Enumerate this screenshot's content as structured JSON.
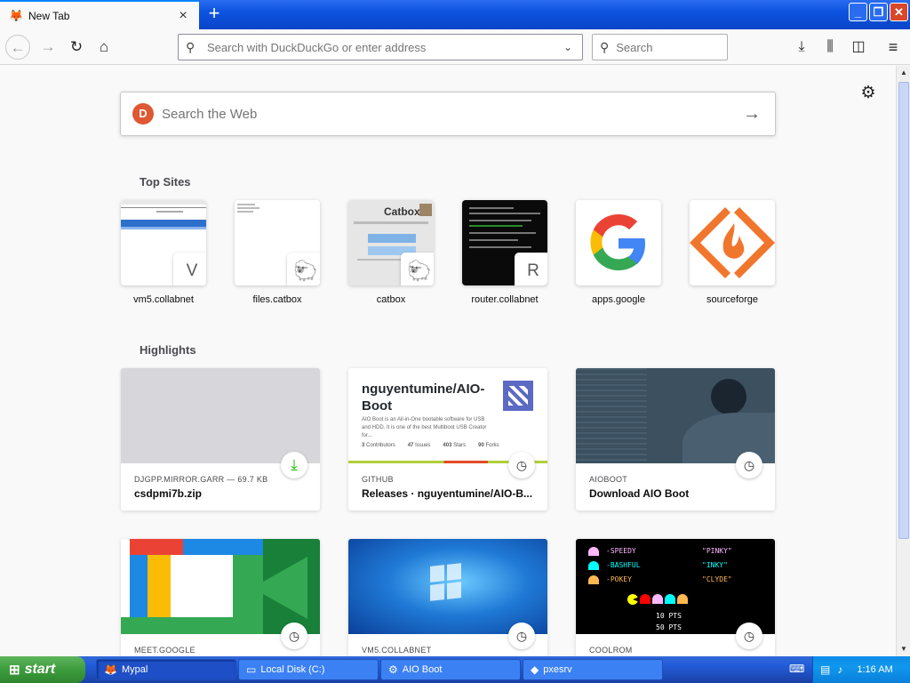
{
  "tab": {
    "title": "New Tab",
    "close_icon": "close-icon",
    "new_tab_icon": "plus-icon"
  },
  "window_buttons": {
    "minimize": "_",
    "maximize": "❐",
    "close": "✕"
  },
  "toolbar": {
    "url_placeholder": "Search with DuckDuckGo or enter address",
    "search_placeholder": "Search"
  },
  "newtab": {
    "search_placeholder": "Search the Web",
    "top_sites_title": "Top Sites",
    "highlights_title": "Highlights",
    "top_sites": [
      {
        "label": "vm5.collabnet",
        "badge": "V"
      },
      {
        "label": "files.catbox",
        "badge": ""
      },
      {
        "label": "catbox",
        "badge": ""
      },
      {
        "label": "router.collabnet",
        "badge": "R"
      },
      {
        "label": "apps.google",
        "badge": ""
      },
      {
        "label": "sourceforge",
        "badge": ""
      }
    ],
    "catbox_logo": "Catbox",
    "highlights": [
      {
        "source": "DJGPP.MIRROR.GARR — 69.7 KB",
        "title": "csdpmi7b.zip"
      },
      {
        "source": "GITHUB",
        "title": "Releases · nguyentumine/AIO-B..."
      },
      {
        "source": "AIOBOOT",
        "title": "Download AIO Boot"
      },
      {
        "source": "MEET.GOOGLE",
        "title": ""
      },
      {
        "source": "VM5.COLLABNET",
        "title": ""
      },
      {
        "source": "COOLROM",
        "title": ""
      }
    ],
    "github_card": {
      "repo": "nguyentumine/AIO-Boot",
      "desc": "AIO Boot is an All-in-One bootable software for USB and HDD. It is one of the best Multiboot USB Creator for...",
      "stats": [
        {
          "num": "3",
          "label": "Contributors"
        },
        {
          "num": "47",
          "label": "Issues"
        },
        {
          "num": "403",
          "label": "Stars"
        },
        {
          "num": "90",
          "label": "Forks"
        }
      ]
    },
    "pacman": [
      {
        "name": "-SPEEDY",
        "nick": "\"PINKY\""
      },
      {
        "name": "-BASHFUL",
        "nick": "\"INKY\""
      },
      {
        "name": "-POKEY",
        "nick": "\"CLYDE\""
      }
    ],
    "pacman_pts": [
      "10 PTS",
      "50 PTS"
    ]
  },
  "taskbar": {
    "start": "start",
    "tasks": [
      {
        "label": "Mypal",
        "active": true
      },
      {
        "label": "Local Disk (C:)",
        "active": false
      },
      {
        "label": "AIO Boot",
        "active": false
      },
      {
        "label": "pxesrv",
        "active": false
      }
    ],
    "clock": "1:16 AM"
  },
  "colors": {
    "accent": "#0a84ff",
    "taskbar": "#245edb",
    "start": "#3c9c3c"
  }
}
